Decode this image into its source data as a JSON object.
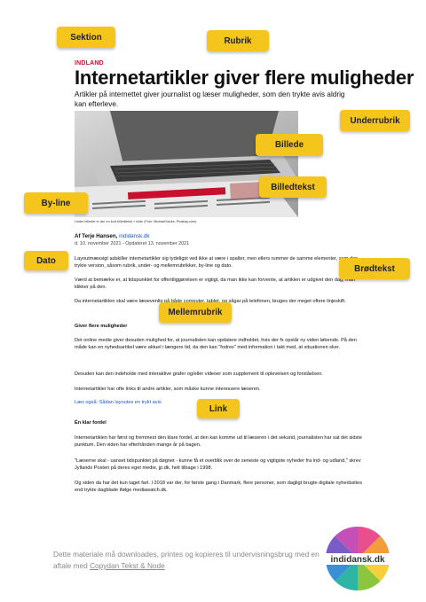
{
  "article": {
    "section": "INDLAND",
    "headline": "Internetartikler giver flere muligheder",
    "subheadline": "Artikler på internettet giver journalist og læser muligheder, som den trykte avis aldrig kan efterleve.",
    "caption": "Under billedet er der en kort billedtekst + kilde (Foto: MichaelSacks, Pixabay.com)",
    "author": "Af Terje Hansen,",
    "author_site": "indidansk.dk",
    "date": "d. 10. november 2021 - Opdateret 13. november 2021",
    "paragraphs": [
      "Layoutmæssigt adskiller internetartikler sig tydeligst ved ikke at være i spalter, men ellers rummer de samme elementer, som den trykte version, såsom rubrik, under- og mellemrubrikker, by-line og dato.",
      "Værd at bemærke er, at tidspunktet for offentliggørelsen er vigtigt, da man ikke kan forvente, at artiklen er udgivet den dag, man klikker på den.",
      "Da internetartiklen skal være læsevenlig på både computer, tablet, og sågar på telefonen, bruges der meget oftere linjeskift."
    ],
    "subtitle_1": "Giver flere muligheder",
    "paragraphs_2": [
      "Det online medie giver desuden mulighed for, at journalisten kan opdatere indholdet, hvis der fx opstår ny viden løbende. På den måde kan en nyhedsartikel være aktuel i længere tid, da den kan \"fodres\" med information i takt med, at situationen sker.",
      "Desuden kan den indeholde med interaktive grafer og/eller videoer som supplement til oplevelsen og forståelsen.",
      "Internetartikler har ofte links til andre artikler, som måske kunne interessere læseren."
    ],
    "link_text": "Læs også: Sådan layoutes en trykt avis",
    "subtitle_2": "Én klar fordel",
    "paragraphs_3": [
      "Internetartiklen har først og fremmest den klare fordel, at den kan komme ud til læseren i det sekund, journalisten har sat det sidste punktum. Den viden har efterhånden mange år på bagen.",
      "\"Læserne skal - uanset tidspunktet på døgnet - kunne få et overblik over de seneste og vigtigste nyheder fra ind- og udland,\" skrev Jyllands Posten på deres eget medie, jp.dk, helt tilbage i 1998.",
      "Og siden da har det kun taget fart. I 2018 var der, for første gang i Danmark, flere personer, som dagligt brugte digitale nyhedssites end trykte dagblade ifølge mediawatch.dk."
    ]
  },
  "labels": {
    "sektion": "Sektion",
    "rubrik": "Rubrik",
    "underrubrik": "Underrubrik",
    "billede": "Billede",
    "billedtekst": "Billedtekst",
    "byline": "By-line",
    "dato": "Dato",
    "brodtekst": "Brødtekst",
    "mellemrubrik": "Mellemrubrik",
    "link": "Link"
  },
  "footer": {
    "text": "Dette materiale må downloades, printes og kopieres til undervisningsbrug med en aftale med",
    "link": "Copydan Tekst & Node"
  },
  "logo": {
    "text": "indidansk.dk"
  },
  "colors": {
    "label_bg": "#f4c51c",
    "section_red": "#c8102e",
    "link_blue": "#1a56c8"
  }
}
